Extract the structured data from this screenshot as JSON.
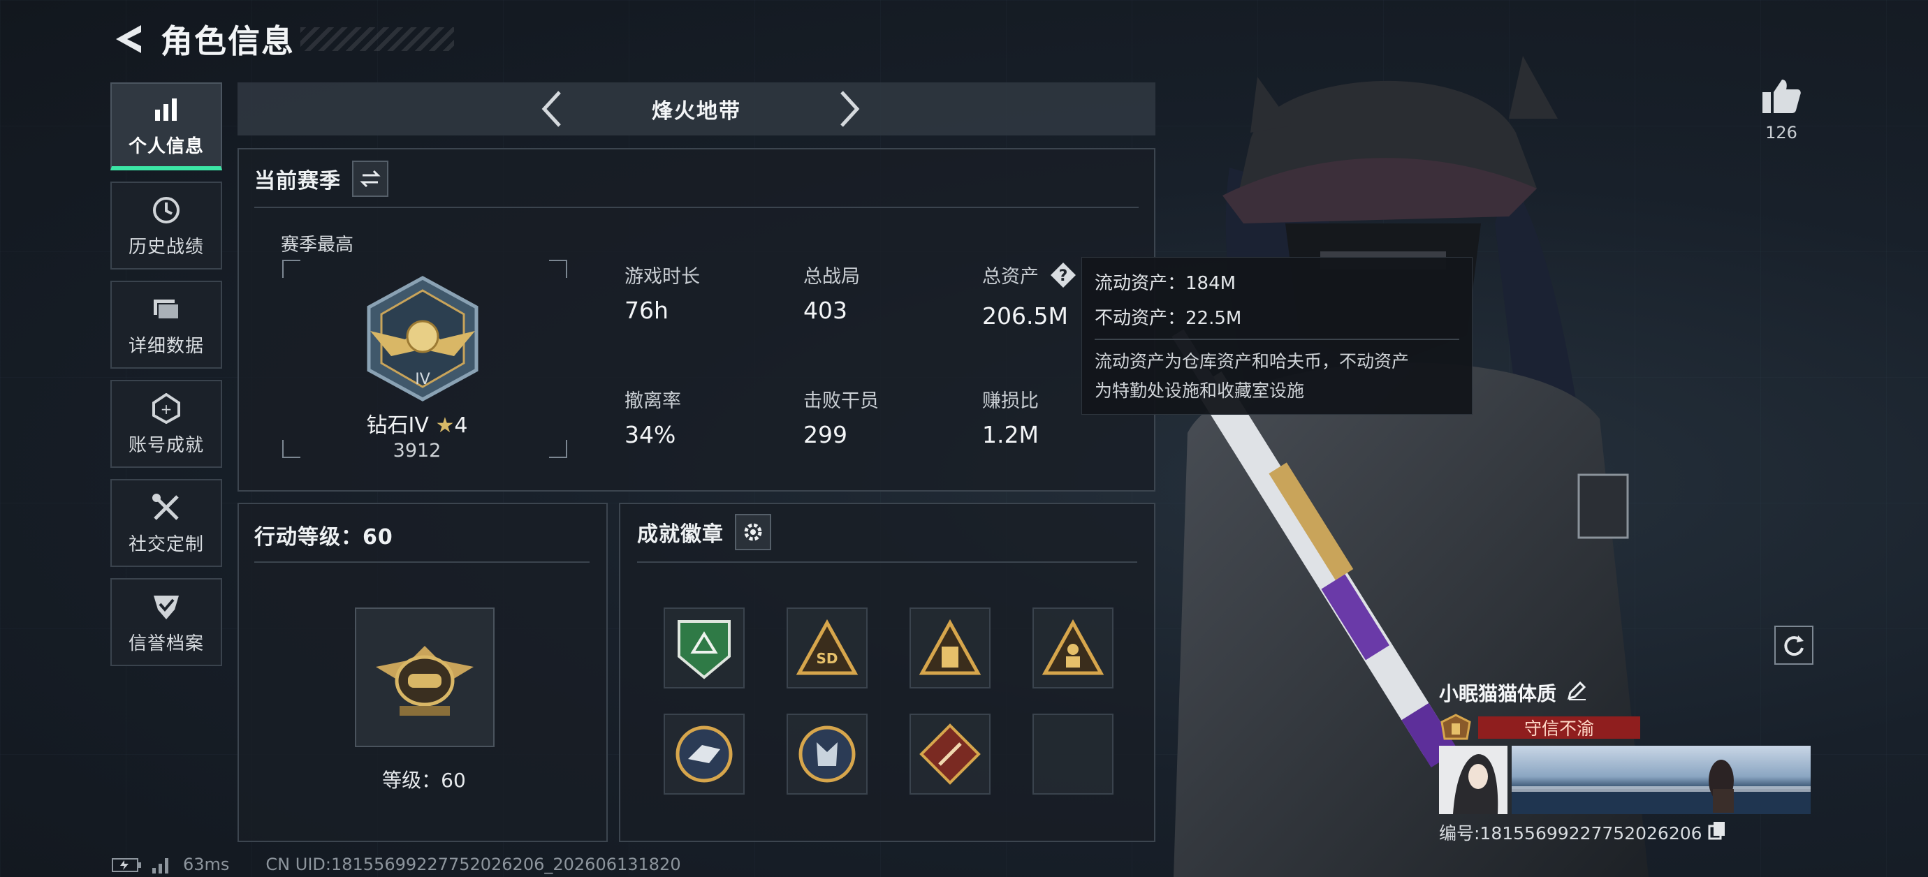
{
  "header": {
    "title": "角色信息"
  },
  "sidebar": {
    "items": [
      {
        "label": "个人信息",
        "icon": "bar-chart-icon",
        "active": true
      },
      {
        "label": "历史战绩",
        "icon": "clock-icon"
      },
      {
        "label": "详细数据",
        "icon": "folder-icon"
      },
      {
        "label": "账号成就",
        "icon": "medal-icon"
      },
      {
        "label": "社交定制",
        "icon": "tools-icon"
      },
      {
        "label": "信誉档案",
        "icon": "shield-check-icon"
      }
    ]
  },
  "mode": {
    "name": "烽火地带"
  },
  "season": {
    "title": "当前赛季",
    "best_label": "赛季最高",
    "rank_name": "钻石IV",
    "rank_stars": "4",
    "rank_score": "3912",
    "stats": [
      {
        "label": "游戏时长",
        "value": "76h"
      },
      {
        "label": "总战局",
        "value": "403"
      },
      {
        "label": "总资产",
        "value": "206.5M"
      },
      {
        "label": "撤离率",
        "value": "34%"
      },
      {
        "label": "击败干员",
        "value": "299"
      },
      {
        "label": "赚损比",
        "value": "1.2M"
      }
    ]
  },
  "tooltip": {
    "liquid": "流动资产：184M",
    "fixed": "不动资产：22.5M",
    "desc_line1": "流动资产为仓库资产和哈夫币，不动资产",
    "desc_line2": "为特勤处设施和收藏室设施"
  },
  "action_level": {
    "title": "行动等级：60",
    "level_text": "等级：60"
  },
  "badges": {
    "title": "成就徽章",
    "items": [
      "green-shield-badge",
      "sd-triangle-badge",
      "tower-triangle-badge",
      "figure-triangle-badge",
      "eagle-round-badge",
      "wolf-round-badge",
      "red-diamond-badge",
      "empty-slot"
    ]
  },
  "profile": {
    "like_count": "126",
    "player_name": "小眠猫猫体质",
    "reputation": "守信不渝",
    "player_id": "编号:18155699227752026206"
  },
  "footer": {
    "ping": "63ms",
    "uid": "CN UID:18155699227752026206_202606131820"
  },
  "colors": {
    "accent": "#3ce6a6",
    "reputation": "#8f1e1e",
    "gold": "#c9a45a"
  }
}
